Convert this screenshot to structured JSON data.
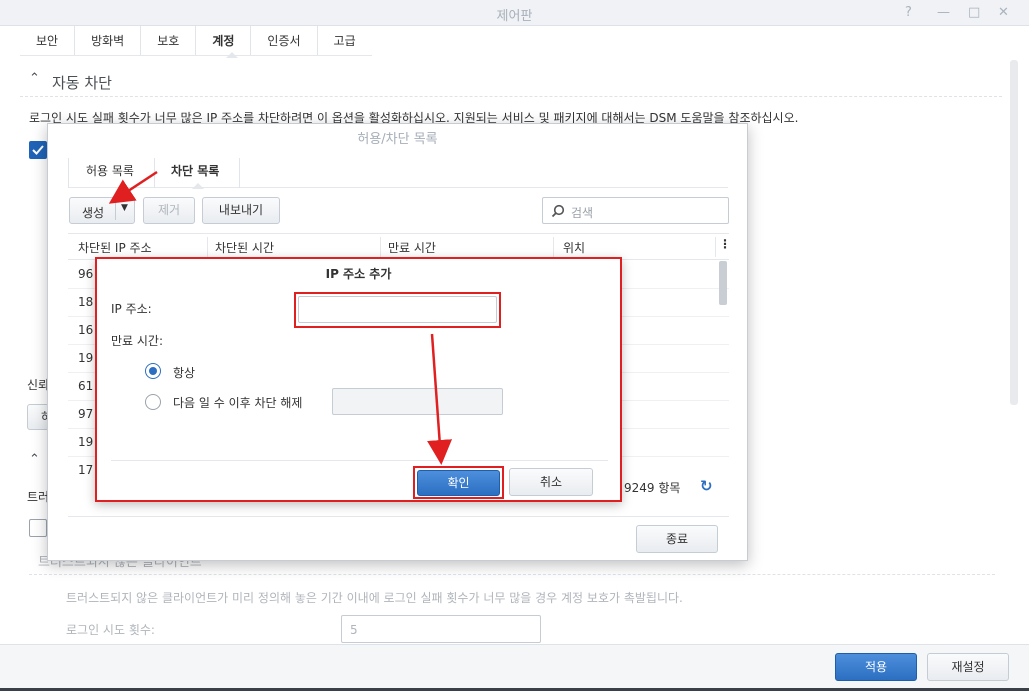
{
  "window": {
    "title": "제어판"
  },
  "window_controls": {
    "help": "?",
    "minimize": "—",
    "maximize": "□",
    "close": "✕"
  },
  "main_tabs": [
    {
      "label": "보안"
    },
    {
      "label": "방화벽"
    },
    {
      "label": "보호"
    },
    {
      "label": "계정"
    },
    {
      "label": "인증서"
    },
    {
      "label": "고급"
    }
  ],
  "auto_block": {
    "title": "자동 차단",
    "description": "로그인 시도 실패 횟수가 너무 많은 IP 주소를 차단하려면 이 옵션을 활성화하십시오. 지원되는 서비스 및 패키지에 대해서는 DSM 도움말을 참조하십시오."
  },
  "background": {
    "trusted_label_partial": "신뢰",
    "button_partial": "허",
    "section_collapsed_char": "트러",
    "untrusted_heading": "트러스트되지 않은 클라이언트",
    "untrusted_desc": "트러스트되지 않은 클라이언트가 미리 정의해 놓은 기간 이내에 로그인 실패 횟수가 너무 많을 경우 계정 보호가 촉발됩니다.",
    "login_attempts_label": "로그인 시도 횟수:",
    "login_attempts_value": "5"
  },
  "footer": {
    "apply": "적용",
    "reset": "재설정"
  },
  "allow_block_dialog": {
    "title": "허용/차단 목록",
    "tabs": [
      {
        "label": "허용 목록"
      },
      {
        "label": "차단 목록"
      }
    ],
    "toolbar": {
      "create": "생성",
      "remove": "제거",
      "export": "내보내기",
      "search_placeholder": "검색"
    },
    "columns": [
      "차단된 IP 주소",
      "차단된 시간",
      "만료 시간",
      "위치"
    ],
    "rows_partial": [
      "96",
      "18",
      "16",
      "19",
      "61",
      "97",
      "19",
      "17"
    ],
    "count_text": "9249 항목",
    "close": "종료"
  },
  "add_ip_modal": {
    "title": "IP 주소 추가",
    "ip_label": "IP 주소:",
    "ip_value": "",
    "expire_label": "만료 시간:",
    "option_always": "항상",
    "option_days": "다음 일 수 이후 차단 해제",
    "days_value": "",
    "ok": "확인",
    "cancel": "취소"
  },
  "colors": {
    "accent": "#2c6fc2",
    "annotation_red": "#e02020",
    "checkbox_blue": "#1f64b8"
  }
}
